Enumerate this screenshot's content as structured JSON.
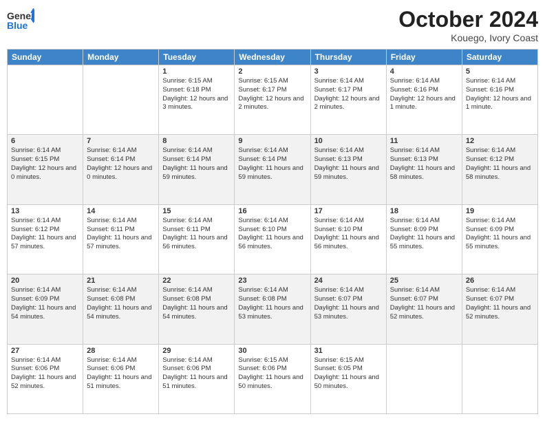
{
  "header": {
    "logo_line1": "General",
    "logo_line2": "Blue",
    "month_title": "October 2024",
    "location": "Kouego, Ivory Coast"
  },
  "days_of_week": [
    "Sunday",
    "Monday",
    "Tuesday",
    "Wednesday",
    "Thursday",
    "Friday",
    "Saturday"
  ],
  "weeks": [
    {
      "shaded": false,
      "days": [
        {
          "num": "",
          "sunrise": "",
          "sunset": "",
          "daylight": ""
        },
        {
          "num": "",
          "sunrise": "",
          "sunset": "",
          "daylight": ""
        },
        {
          "num": "1",
          "sunrise": "Sunrise: 6:15 AM",
          "sunset": "Sunset: 6:18 PM",
          "daylight": "Daylight: 12 hours and 3 minutes."
        },
        {
          "num": "2",
          "sunrise": "Sunrise: 6:15 AM",
          "sunset": "Sunset: 6:17 PM",
          "daylight": "Daylight: 12 hours and 2 minutes."
        },
        {
          "num": "3",
          "sunrise": "Sunrise: 6:14 AM",
          "sunset": "Sunset: 6:17 PM",
          "daylight": "Daylight: 12 hours and 2 minutes."
        },
        {
          "num": "4",
          "sunrise": "Sunrise: 6:14 AM",
          "sunset": "Sunset: 6:16 PM",
          "daylight": "Daylight: 12 hours and 1 minute."
        },
        {
          "num": "5",
          "sunrise": "Sunrise: 6:14 AM",
          "sunset": "Sunset: 6:16 PM",
          "daylight": "Daylight: 12 hours and 1 minute."
        }
      ]
    },
    {
      "shaded": true,
      "days": [
        {
          "num": "6",
          "sunrise": "Sunrise: 6:14 AM",
          "sunset": "Sunset: 6:15 PM",
          "daylight": "Daylight: 12 hours and 0 minutes."
        },
        {
          "num": "7",
          "sunrise": "Sunrise: 6:14 AM",
          "sunset": "Sunset: 6:14 PM",
          "daylight": "Daylight: 12 hours and 0 minutes."
        },
        {
          "num": "8",
          "sunrise": "Sunrise: 6:14 AM",
          "sunset": "Sunset: 6:14 PM",
          "daylight": "Daylight: 11 hours and 59 minutes."
        },
        {
          "num": "9",
          "sunrise": "Sunrise: 6:14 AM",
          "sunset": "Sunset: 6:14 PM",
          "daylight": "Daylight: 11 hours and 59 minutes."
        },
        {
          "num": "10",
          "sunrise": "Sunrise: 6:14 AM",
          "sunset": "Sunset: 6:13 PM",
          "daylight": "Daylight: 11 hours and 59 minutes."
        },
        {
          "num": "11",
          "sunrise": "Sunrise: 6:14 AM",
          "sunset": "Sunset: 6:13 PM",
          "daylight": "Daylight: 11 hours and 58 minutes."
        },
        {
          "num": "12",
          "sunrise": "Sunrise: 6:14 AM",
          "sunset": "Sunset: 6:12 PM",
          "daylight": "Daylight: 11 hours and 58 minutes."
        }
      ]
    },
    {
      "shaded": false,
      "days": [
        {
          "num": "13",
          "sunrise": "Sunrise: 6:14 AM",
          "sunset": "Sunset: 6:12 PM",
          "daylight": "Daylight: 11 hours and 57 minutes."
        },
        {
          "num": "14",
          "sunrise": "Sunrise: 6:14 AM",
          "sunset": "Sunset: 6:11 PM",
          "daylight": "Daylight: 11 hours and 57 minutes."
        },
        {
          "num": "15",
          "sunrise": "Sunrise: 6:14 AM",
          "sunset": "Sunset: 6:11 PM",
          "daylight": "Daylight: 11 hours and 56 minutes."
        },
        {
          "num": "16",
          "sunrise": "Sunrise: 6:14 AM",
          "sunset": "Sunset: 6:10 PM",
          "daylight": "Daylight: 11 hours and 56 minutes."
        },
        {
          "num": "17",
          "sunrise": "Sunrise: 6:14 AM",
          "sunset": "Sunset: 6:10 PM",
          "daylight": "Daylight: 11 hours and 56 minutes."
        },
        {
          "num": "18",
          "sunrise": "Sunrise: 6:14 AM",
          "sunset": "Sunset: 6:09 PM",
          "daylight": "Daylight: 11 hours and 55 minutes."
        },
        {
          "num": "19",
          "sunrise": "Sunrise: 6:14 AM",
          "sunset": "Sunset: 6:09 PM",
          "daylight": "Daylight: 11 hours and 55 minutes."
        }
      ]
    },
    {
      "shaded": true,
      "days": [
        {
          "num": "20",
          "sunrise": "Sunrise: 6:14 AM",
          "sunset": "Sunset: 6:09 PM",
          "daylight": "Daylight: 11 hours and 54 minutes."
        },
        {
          "num": "21",
          "sunrise": "Sunrise: 6:14 AM",
          "sunset": "Sunset: 6:08 PM",
          "daylight": "Daylight: 11 hours and 54 minutes."
        },
        {
          "num": "22",
          "sunrise": "Sunrise: 6:14 AM",
          "sunset": "Sunset: 6:08 PM",
          "daylight": "Daylight: 11 hours and 54 minutes."
        },
        {
          "num": "23",
          "sunrise": "Sunrise: 6:14 AM",
          "sunset": "Sunset: 6:08 PM",
          "daylight": "Daylight: 11 hours and 53 minutes."
        },
        {
          "num": "24",
          "sunrise": "Sunrise: 6:14 AM",
          "sunset": "Sunset: 6:07 PM",
          "daylight": "Daylight: 11 hours and 53 minutes."
        },
        {
          "num": "25",
          "sunrise": "Sunrise: 6:14 AM",
          "sunset": "Sunset: 6:07 PM",
          "daylight": "Daylight: 11 hours and 52 minutes."
        },
        {
          "num": "26",
          "sunrise": "Sunrise: 6:14 AM",
          "sunset": "Sunset: 6:07 PM",
          "daylight": "Daylight: 11 hours and 52 minutes."
        }
      ]
    },
    {
      "shaded": false,
      "days": [
        {
          "num": "27",
          "sunrise": "Sunrise: 6:14 AM",
          "sunset": "Sunset: 6:06 PM",
          "daylight": "Daylight: 11 hours and 52 minutes."
        },
        {
          "num": "28",
          "sunrise": "Sunrise: 6:14 AM",
          "sunset": "Sunset: 6:06 PM",
          "daylight": "Daylight: 11 hours and 51 minutes."
        },
        {
          "num": "29",
          "sunrise": "Sunrise: 6:14 AM",
          "sunset": "Sunset: 6:06 PM",
          "daylight": "Daylight: 11 hours and 51 minutes."
        },
        {
          "num": "30",
          "sunrise": "Sunrise: 6:15 AM",
          "sunset": "Sunset: 6:06 PM",
          "daylight": "Daylight: 11 hours and 50 minutes."
        },
        {
          "num": "31",
          "sunrise": "Sunrise: 6:15 AM",
          "sunset": "Sunset: 6:05 PM",
          "daylight": "Daylight: 11 hours and 50 minutes."
        },
        {
          "num": "",
          "sunrise": "",
          "sunset": "",
          "daylight": ""
        },
        {
          "num": "",
          "sunrise": "",
          "sunset": "",
          "daylight": ""
        }
      ]
    }
  ]
}
